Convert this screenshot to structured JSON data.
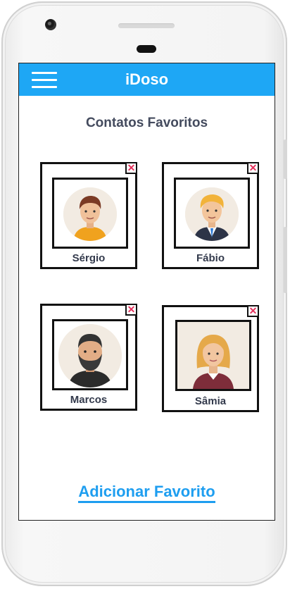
{
  "app": {
    "title": "iDoso"
  },
  "page": {
    "section_title": "Contatos Favoritos",
    "add_label": "Adicionar Favorito"
  },
  "contacts": [
    {
      "name": "Sérgio",
      "remove_glyph": "✕",
      "avatar_icon": "man-orange-shirt-avatar"
    },
    {
      "name": "Fábio",
      "remove_glyph": "✕",
      "avatar_icon": "blond-man-suit-avatar"
    },
    {
      "name": "Marcos",
      "remove_glyph": "✕",
      "avatar_icon": "bearded-man-avatar"
    },
    {
      "name": "Sâmia",
      "remove_glyph": "✕",
      "avatar_icon": "woman-blonde-avatar"
    }
  ],
  "colors": {
    "accent": "#1ea7f5",
    "close": "#e3305b",
    "text": "#444b5e"
  }
}
